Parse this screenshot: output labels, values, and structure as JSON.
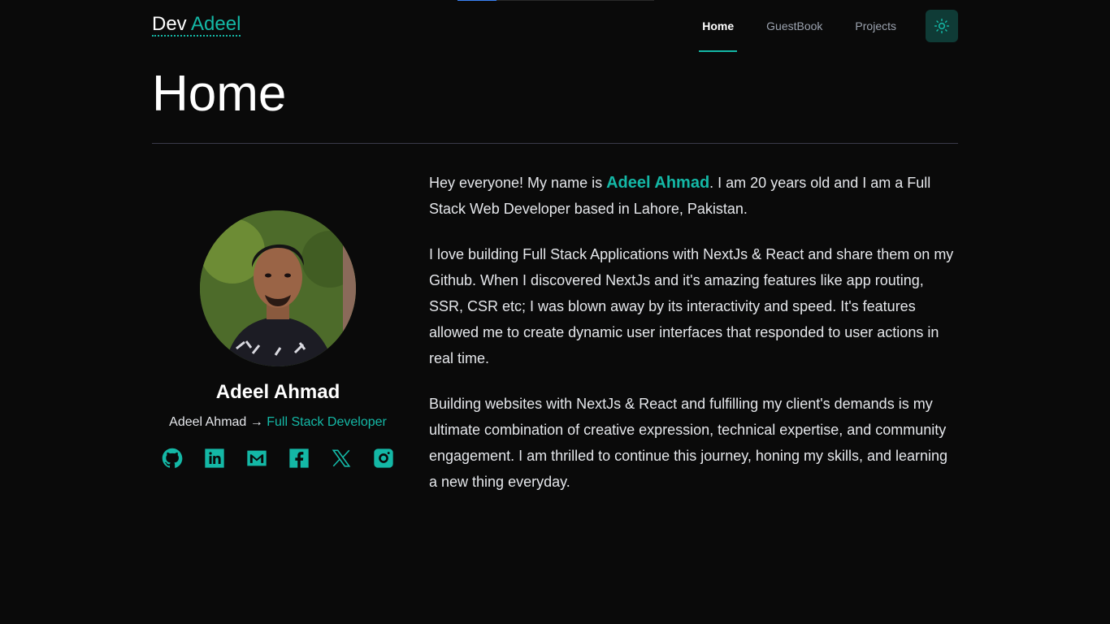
{
  "progress": {
    "fraction": 0.2
  },
  "header": {
    "logo_first": "Dev",
    "logo_second": "Adeel",
    "nav": [
      {
        "label": "Home",
        "active": true
      },
      {
        "label": "GuestBook",
        "active": false
      },
      {
        "label": "Projects",
        "active": false
      }
    ],
    "theme_icon": "sun-icon"
  },
  "page": {
    "title": "Home"
  },
  "profile": {
    "name": "Adeel Ahmad",
    "role_prefix": "Adeel Ahmad",
    "arrow": "→",
    "role_title": "Full Stack Developer",
    "socials": [
      "github-icon",
      "linkedin-icon",
      "mail-icon",
      "facebook-icon",
      "x-icon",
      "instagram-icon"
    ]
  },
  "bio": {
    "p1_before": "Hey everyone! My name is ",
    "p1_name": "Adeel Ahmad",
    "p1_after": ". I am 20 years old and I am a Full Stack Web Developer based in Lahore, Pakistan.",
    "p2": "I love building Full Stack Applications with NextJs & React and share them on my Github. When I discovered NextJs and it's amazing features like app routing, SSR, CSR etc; I was blown away by its interactivity and speed. It's features allowed me to create dynamic user interfaces that responded to user actions in real time.",
    "p3": "Building websites with NextJs & React and fulfilling my client's demands is my ultimate combination of creative expression, technical expertise, and community engagement. I am thrilled to continue this journey, honing my skills, and learning a new thing everyday."
  },
  "colors": {
    "accent": "#14b8a6",
    "background": "#0a0a0a"
  }
}
